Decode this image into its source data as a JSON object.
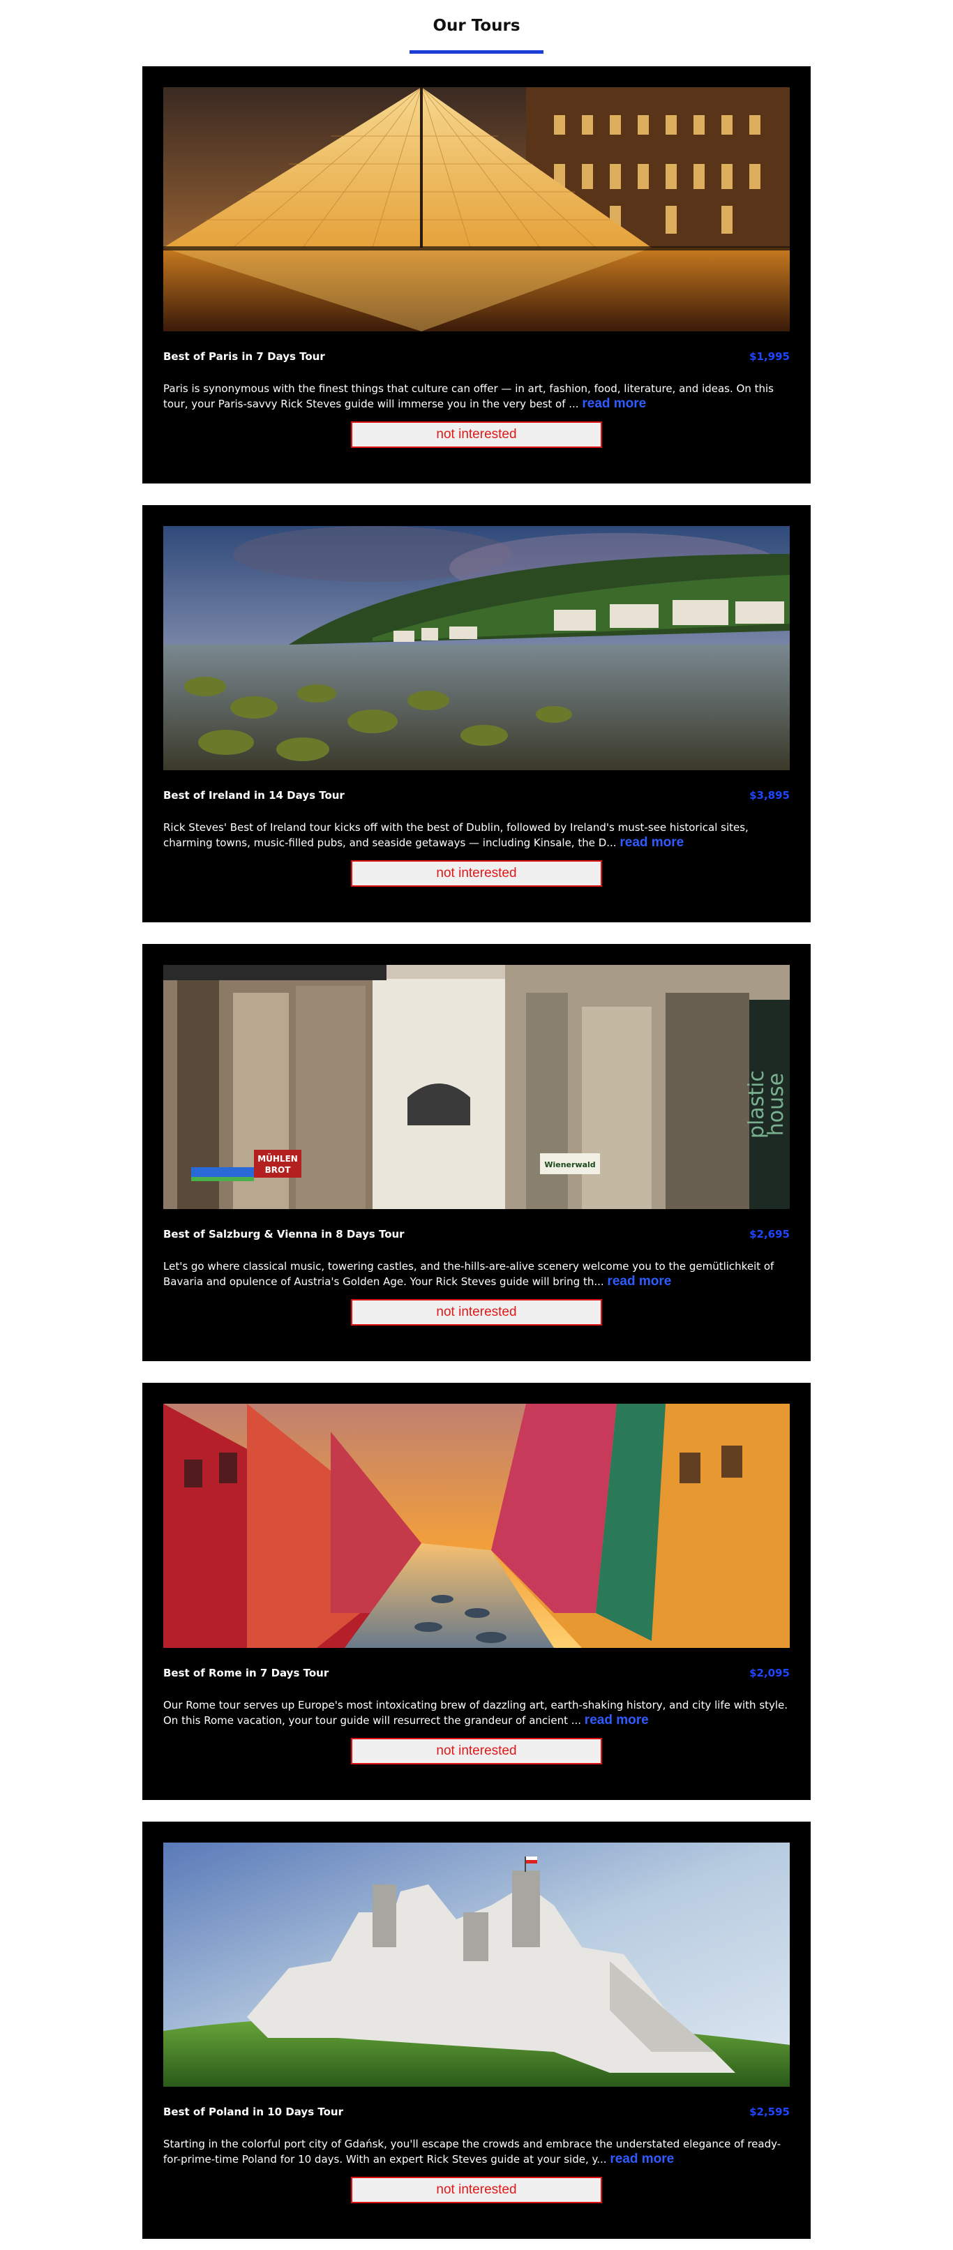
{
  "page": {
    "title": "Our Tours"
  },
  "tours": [
    {
      "name": "Best of Paris in 7 Days Tour",
      "price": "$1,995",
      "description": "Paris is synonymous with the finest things that culture can offer — in art, fashion, food, literature, and ideas. On this tour, your Paris-savvy Rick Steves guide will immerse you in the very best of ... ",
      "read_more": "read more",
      "button": "not interested"
    },
    {
      "name": "Best of Ireland in 14 Days Tour",
      "price": "$3,895",
      "description": "Rick Steves' Best of Ireland tour kicks off with the best of Dublin, followed by Ireland's must-see historical sites, charming towns, music-filled pubs, and seaside getaways — including Kinsale, the D... ",
      "read_more": "read more",
      "button": "not interested"
    },
    {
      "name": "Best of Salzburg & Vienna in 8 Days Tour",
      "price": "$2,695",
      "description": "Let's go where classical music, towering castles, and the-hills-are-alive scenery welcome you to the gemütlichkeit of Bavaria and opulence of Austria's Golden Age. Your Rick Steves guide will bring th... ",
      "read_more": "read more",
      "button": "not interested",
      "image_signs": {
        "bakery": "MÜHLEN BROT",
        "shop": "plastic house",
        "restaurant": "Wienerwald"
      }
    },
    {
      "name": "Best of Rome in 7 Days Tour",
      "price": "$2,095",
      "description": "Our Rome tour serves up Europe's most intoxicating brew of dazzling art, earth-shaking history, and city life with style. On this Rome vacation, your tour guide will resurrect the grandeur of ancient ... ",
      "read_more": "read more",
      "button": "not interested"
    },
    {
      "name": "Best of Poland in 10 Days Tour",
      "price": "$2,595",
      "description": "Starting in the colorful port city of Gdańsk, you'll escape the crowds and embrace the understated elegance of ready-for-prime-time Poland for 10 days. With an expert Rick Steves guide at your side, y... ",
      "read_more": "read more",
      "button": "not interested"
    }
  ],
  "colors": {
    "accent": "#1b3fd6",
    "price": "#1e46ff",
    "read_more": "#2f5bff",
    "button_border": "#dd1111",
    "card_bg": "#000000"
  }
}
